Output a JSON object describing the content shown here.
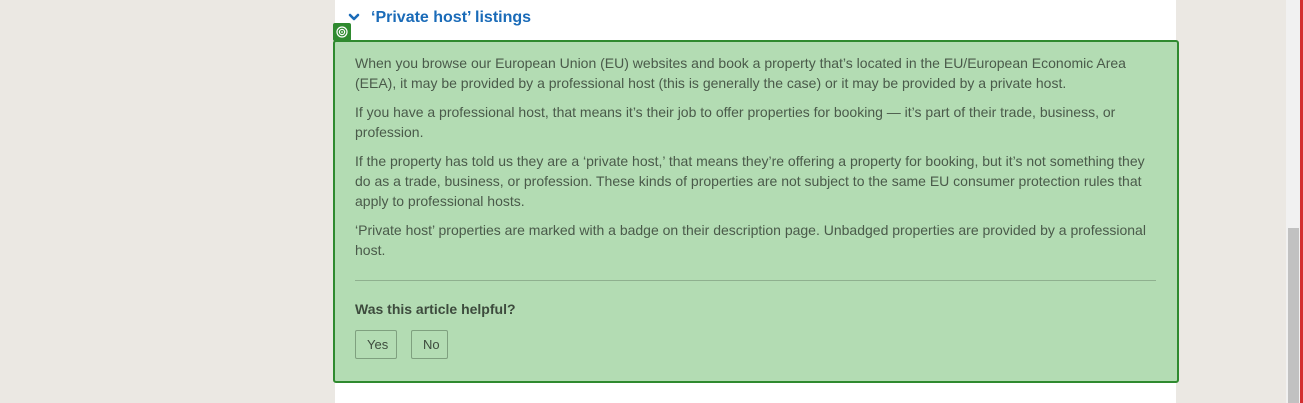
{
  "colors": {
    "page_background": "#ebe8e3",
    "card_background": "#ffffff",
    "highlight_fill": "#b3dcb3",
    "highlight_border": "#2f8a2f",
    "title_link": "#1a6bb8",
    "right_edge_marker": "#d32f2f"
  },
  "faq": {
    "expand_icon": "chevron-down-icon",
    "title": "‘Private host’ listings",
    "target_icon": "target-icon",
    "paragraphs": [
      "When you browse our European Union (EU) websites and book a property that’s located in the EU/European Economic Area (EEA), it may be provided by a professional host (this is generally the case) or it may be provided by a private host.",
      "If you have a professional host, that means it’s their job to offer properties for booking — it’s part of their trade, business, or profession.",
      "If the property has told us they are a ‘private host,’ that means they’re offering a property for booking, but it’s not something they do as a trade, business, or profession. These kinds of properties are not subject to the same EU consumer protection rules that apply to professional hosts.",
      "‘Private host’ properties are marked with a badge on their description page. Unbadged properties are provided by a professional host."
    ]
  },
  "feedback": {
    "question": "Was this article helpful?",
    "yes_label": "Yes",
    "no_label": "No"
  }
}
